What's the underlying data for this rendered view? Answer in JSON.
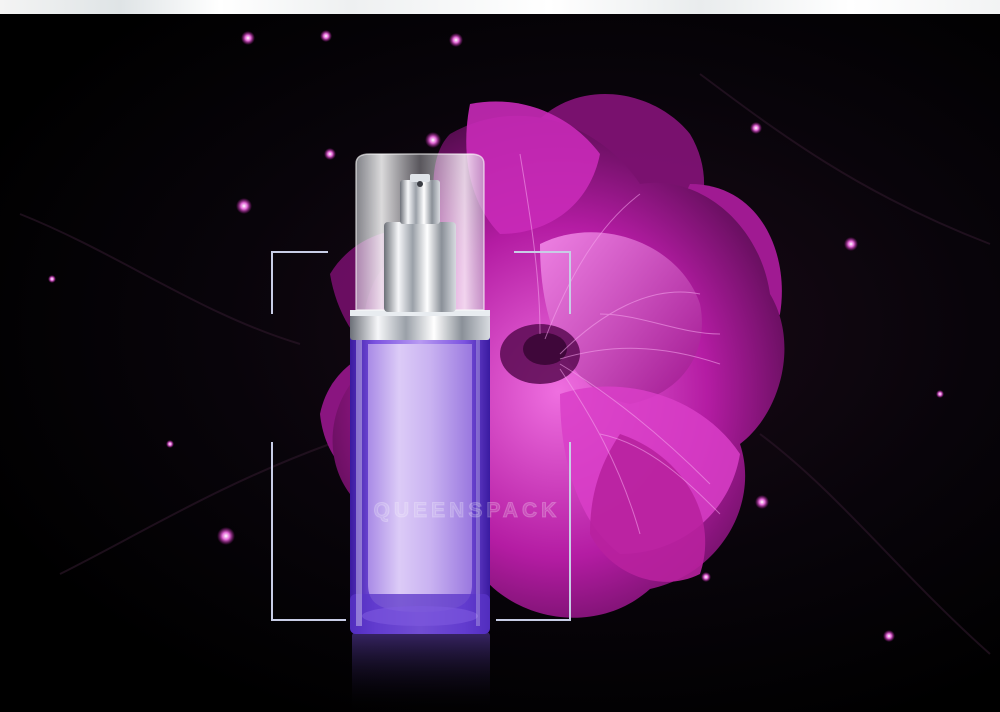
{
  "image": {
    "watermark_text": "QUEENSPACK",
    "colors": {
      "background": "#000000",
      "flower": "#b0199c",
      "flower_highlight": "#e85ad6",
      "bottle_liquid": "#c9aef0",
      "bottle_glass": "#6a3fd0",
      "cap": "#e8ecef",
      "bracket_lines": "#c8cde6"
    }
  }
}
